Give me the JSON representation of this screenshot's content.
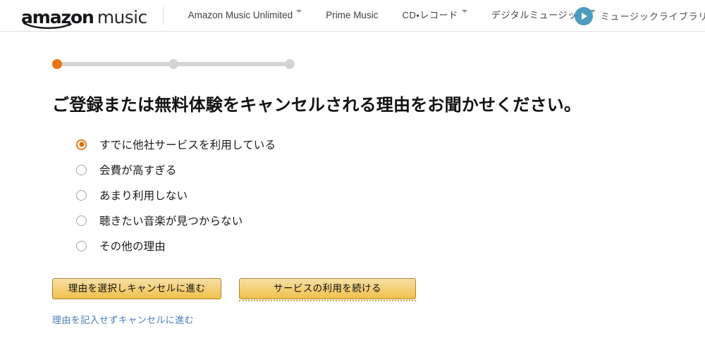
{
  "header": {
    "logo": {
      "amazon": "amazon",
      "music": "music",
      "icon": "amazon-smile-arrow"
    },
    "nav": [
      {
        "label": "Amazon Music Unlimited",
        "has_caret": true,
        "jp": false
      },
      {
        "label": "Prime Music",
        "has_caret": false,
        "jp": false
      },
      {
        "label": "CD・レコード",
        "has_caret": true,
        "jp": true
      },
      {
        "label": "デジタルミュージック",
        "has_caret": true,
        "jp": true
      }
    ],
    "library": {
      "play_icon": "play-icon",
      "label": "ミュージックライブラリを開く"
    }
  },
  "progress": {
    "steps": [
      {
        "label": "step-1",
        "active": true
      },
      {
        "label": "step-2",
        "active": false
      },
      {
        "label": "step-3",
        "active": false
      }
    ]
  },
  "main": {
    "headline": "ご登録または無料体験をキャンセルされる理由をお聞かせください。",
    "options": [
      {
        "label": "すでに他社サービスを利用している",
        "checked": true
      },
      {
        "label": "会費が高すぎる",
        "checked": false
      },
      {
        "label": "あまり利用しない",
        "checked": false
      },
      {
        "label": "聴きたい音楽が見つからない",
        "checked": false
      },
      {
        "label": "その他の理由",
        "checked": false
      }
    ],
    "buttons": {
      "primary": "理由を選択しキャンセルに進む",
      "secondary": "サービスの利用を続ける"
    },
    "skip_link": "理由を記入せずキャンセルに進む"
  },
  "colors": {
    "accent_orange": "#e87511",
    "button_gold_top": "#f7dfa5",
    "button_gold_bottom": "#f0c14b",
    "button_border": "#a88734",
    "play_teal": "#4b9dbe",
    "link_blue": "#4a7ebb",
    "track_gray": "#d3d4d6"
  }
}
